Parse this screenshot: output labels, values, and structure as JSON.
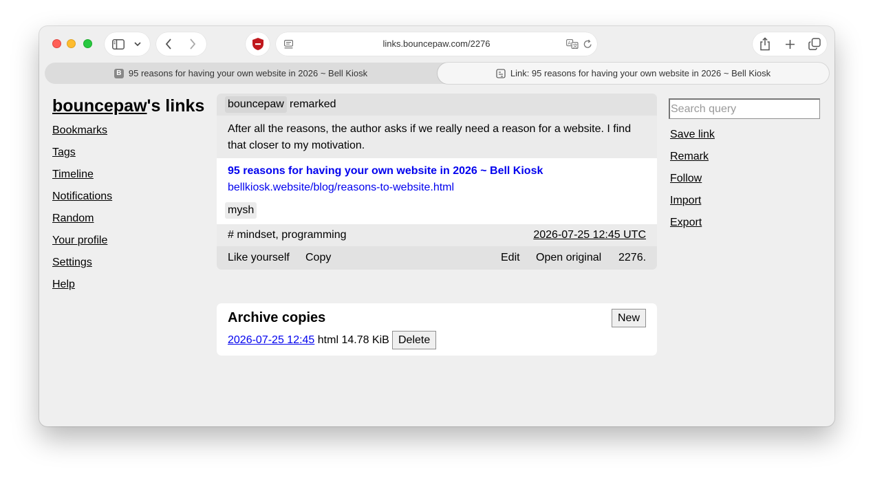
{
  "browser": {
    "url": "links.bouncepaw.com/2276",
    "tabs": [
      {
        "favicon": "B",
        "title": "95 reasons for having your own website in 2026 ~ Bell Kiosk",
        "active": false
      },
      {
        "favicon": "link-icon",
        "title": "Link: 95 reasons for having your own website in 2026 ~ Bell Kiosk",
        "active": true
      }
    ],
    "icons": [
      "sidebar-icon",
      "chevron-down-icon",
      "back-icon",
      "forward-icon",
      "shield-icon",
      "reader-icon",
      "translate-icon",
      "reload-icon",
      "share-icon",
      "plus-icon",
      "tabs-overview-icon"
    ]
  },
  "site": {
    "title_user": "bouncepaw",
    "title_rest": "'s links"
  },
  "nav": [
    "Bookmarks",
    "Tags",
    "Timeline",
    "Notifications",
    "Random",
    "Your profile",
    "Settings",
    "Help"
  ],
  "post": {
    "author": "bouncepaw",
    "verb": "remarked",
    "remark": "After all the reasons, the author asks if we really need a reason for a website. I find that closer to my motivation.",
    "link_title": "95 reasons for having your own website in 2026 ~ Bell Kiosk",
    "link_url": "bellkiosk.website/blog/reasons-to-website.html",
    "original_author": "mysh",
    "tags": "# mindset, programming",
    "date": "2026-07-25 12:45 UTC",
    "actions": {
      "like": "Like yourself",
      "copy": "Copy",
      "edit": "Edit",
      "open_original": "Open original",
      "id": "2276."
    }
  },
  "archive": {
    "title": "Archive copies",
    "new_button": "New",
    "copies": [
      {
        "date": "2026-07-25 12:45",
        "info": "html 14.78 KiB",
        "delete_label": "Delete"
      }
    ]
  },
  "sidebar_right": {
    "search_placeholder": "Search query",
    "links": [
      "Save link",
      "Remark",
      "Follow",
      "Import",
      "Export"
    ]
  },
  "colors": {
    "link": "#0000ee",
    "page_bg": "#efefef",
    "traffic_red": "#ff5f57",
    "traffic_yellow": "#febc2e",
    "traffic_green": "#28c840",
    "shield": "#c0181d"
  }
}
